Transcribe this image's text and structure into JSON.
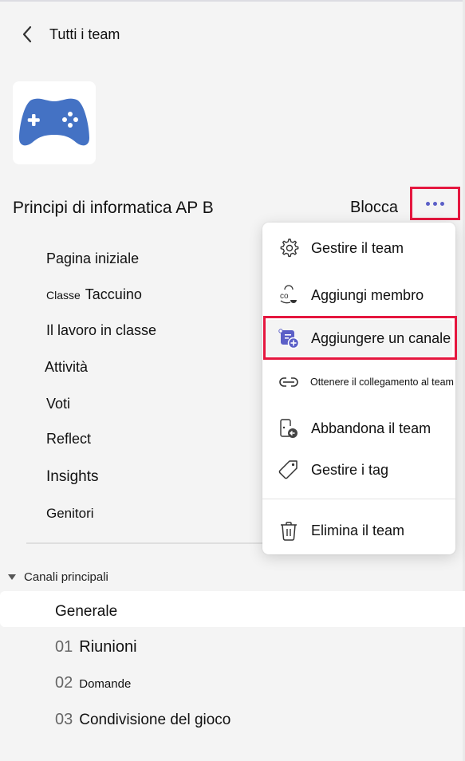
{
  "header": {
    "back_label": "Tutti i team"
  },
  "team": {
    "name": "Principi di informatica AP B",
    "logo_icon": "gamepad-icon",
    "logo_color": "#4472c4",
    "pin_label": "Blocca",
    "more_icon": "more-horizontal-icon"
  },
  "nav": {
    "items": [
      {
        "label": "Pagina iniziale"
      },
      {
        "prefix": "Classe",
        "label": "Taccuino"
      },
      {
        "label": "Il lavoro in classe"
      },
      {
        "label": "Attività"
      },
      {
        "label": "Voti"
      },
      {
        "label": "Reflect"
      },
      {
        "label": "Insights"
      },
      {
        "label": "Genitori"
      }
    ]
  },
  "channels": {
    "section_label": "Canali principali",
    "items": [
      {
        "num": "",
        "name": "Generale",
        "active": true
      },
      {
        "num": "01",
        "name": "Riunioni"
      },
      {
        "num": "02",
        "name": "Domande"
      },
      {
        "num": "03",
        "name": "Condivisione del gioco"
      }
    ]
  },
  "context_menu": {
    "items": [
      {
        "icon": "gear-icon",
        "label": "Gestire il team"
      },
      {
        "icon": "add-member-icon",
        "label": "Aggiungi membro"
      },
      {
        "icon": "add-channel-icon",
        "label": "Aggiungere un canale",
        "highlighted": true
      },
      {
        "icon": "link-icon",
        "label": "Ottenere il collegamento al team"
      },
      {
        "icon": "leave-icon",
        "label": "Abbandona il team"
      },
      {
        "icon": "tag-icon",
        "label": "Gestire i tag"
      },
      {
        "icon": "trash-icon",
        "label": "Elimina il team"
      }
    ]
  },
  "colors": {
    "accent": "#5b5fc7",
    "highlight_border": "#e5173f",
    "background": "#f4f4f4"
  }
}
